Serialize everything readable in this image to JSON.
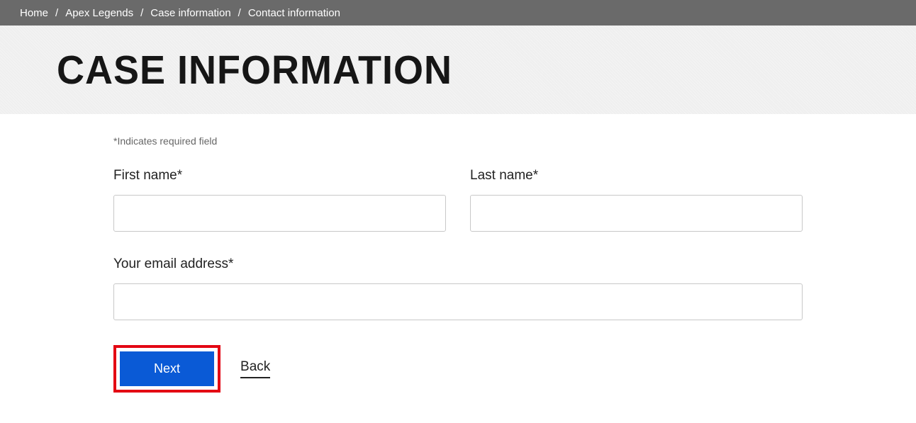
{
  "breadcrumb": {
    "items": [
      "Home",
      "Apex Legends",
      "Case information",
      "Contact information"
    ]
  },
  "header": {
    "title": "CASE INFORMATION"
  },
  "form": {
    "required_note": "*Indicates required field",
    "first_name_label": "First name*",
    "first_name_value": "",
    "last_name_label": "Last name*",
    "last_name_value": "",
    "email_label": "Your email address*",
    "email_value": ""
  },
  "buttons": {
    "next_label": "Next",
    "back_label": "Back"
  }
}
